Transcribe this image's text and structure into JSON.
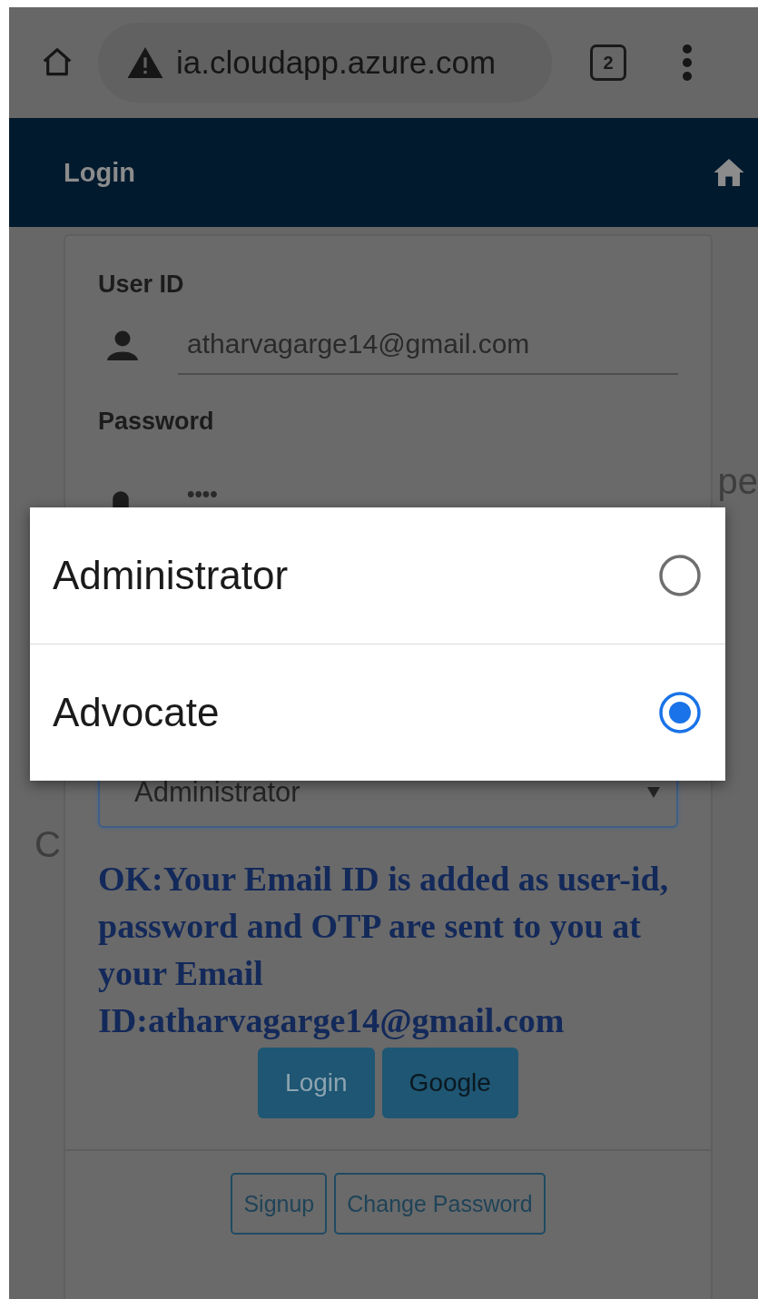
{
  "browser": {
    "url": "ia.cloudapp.azure.com",
    "tab_count": "2"
  },
  "header": {
    "title": "Login"
  },
  "form": {
    "user_id_label": "User ID",
    "user_id_value": "atharvagarge14@gmail.com",
    "password_label": "Password",
    "password_value": "••••",
    "role_select": "Administrator",
    "message": "OK:Your Email ID is added as user-id, password and OTP are sent to you at your Email ID:atharvagarge14@gmail.com",
    "buttons": [
      {
        "label": "Login",
        "kind": "primary"
      },
      {
        "label": "Google",
        "kind": "dark"
      }
    ],
    "footer_buttons": [
      "Signup",
      "Change Password"
    ]
  },
  "background_fragments": [
    "pe",
    "C"
  ],
  "dialog": {
    "options": [
      {
        "label": "Administrator",
        "selected": false
      },
      {
        "label": "Advocate",
        "selected": true
      }
    ]
  }
}
